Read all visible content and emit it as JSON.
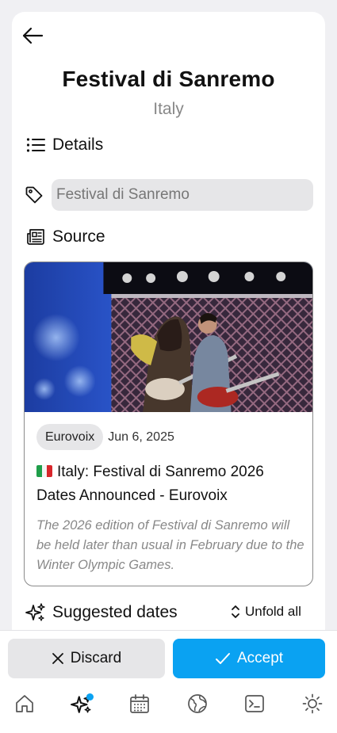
{
  "header": {
    "title": "Festival di Sanremo",
    "subtitle": "Italy"
  },
  "details": {
    "label": "Details",
    "tag_value": "Festival di Sanremo",
    "tag_placeholder": "Festival di Sanremo"
  },
  "source": {
    "label": "Source",
    "publisher": "Eurovoix",
    "date": "Jun 6, 2025",
    "flag": "italy-flag",
    "title": "Italy: Festival di Sanremo 2026 Dates Announced - Eurovoix",
    "description": "The 2026 edition of Festival di Sanremo will be held later than usual in February due to the Winter Olympic Games."
  },
  "suggested": {
    "label": "Suggested dates",
    "unfold_label": "Unfold all"
  },
  "actions": {
    "discard_label": "Discard",
    "accept_label": "Accept"
  },
  "nav": {
    "items": [
      "home-icon",
      "sparkles-icon",
      "calendar-icon",
      "globe-icon",
      "terminal-icon",
      "sun-icon"
    ],
    "active": "sparkles-icon"
  },
  "colors": {
    "accent": "#0aa2f2",
    "input_bg": "#e6e6e8",
    "muted_text": "#888888"
  }
}
